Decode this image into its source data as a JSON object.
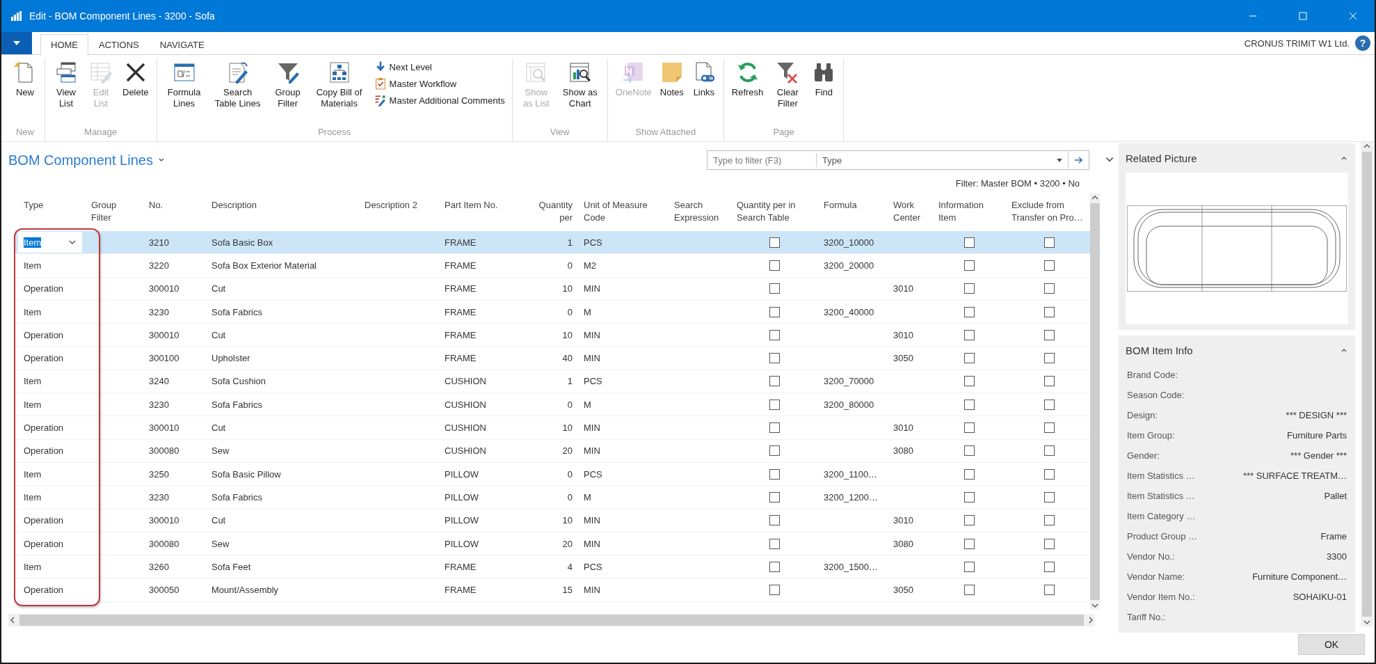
{
  "window": {
    "title": "Edit - BOM Component Lines - 3200 - Sofa"
  },
  "menu_tabs": [
    {
      "label": "HOME",
      "selected": true
    },
    {
      "label": "ACTIONS",
      "selected": false
    },
    {
      "label": "NAVIGATE",
      "selected": false
    }
  ],
  "company": "CRONUS TRIMIT W1 Ltd.",
  "help_button": "?",
  "ribbon": [
    {
      "label": "New",
      "items": [
        {
          "label": "New",
          "kind": "large",
          "disabled": false
        }
      ]
    },
    {
      "label": "Manage",
      "items": [
        {
          "label": "View List",
          "kind": "large",
          "disabled": false
        },
        {
          "label": "Edit List",
          "kind": "large",
          "disabled": true
        },
        {
          "label": "Delete",
          "kind": "large",
          "disabled": false
        }
      ]
    },
    {
      "label": "Process",
      "items": [
        {
          "label": "Formula Lines",
          "kind": "large",
          "disabled": false
        },
        {
          "label": "Search Table Lines",
          "kind": "large",
          "disabled": false
        },
        {
          "label": "Group Filter",
          "kind": "large",
          "disabled": false
        },
        {
          "label": "Copy Bill of Materials",
          "kind": "large",
          "disabled": false
        },
        {
          "label": "Next Level",
          "kind": "small",
          "disabled": false
        },
        {
          "label": "Master Workflow",
          "kind": "small",
          "disabled": false
        },
        {
          "label": "Master Additional Comments",
          "kind": "small",
          "disabled": false
        }
      ]
    },
    {
      "label": "View",
      "items": [
        {
          "label": "Show as List",
          "kind": "large",
          "disabled": true
        },
        {
          "label": "Show as Chart",
          "kind": "large",
          "disabled": false
        }
      ]
    },
    {
      "label": "Show Attached",
      "items": [
        {
          "label": "OneNote",
          "kind": "large",
          "disabled": true
        },
        {
          "label": "Notes",
          "kind": "large",
          "disabled": false
        },
        {
          "label": "Links",
          "kind": "large",
          "disabled": false
        }
      ]
    },
    {
      "label": "Page",
      "items": [
        {
          "label": "Refresh",
          "kind": "large",
          "disabled": false
        },
        {
          "label": "Clear Filter",
          "kind": "large",
          "disabled": false
        },
        {
          "label": "Find",
          "kind": "large",
          "disabled": false
        }
      ]
    }
  ],
  "page": {
    "title": "BOM Component Lines",
    "search": {
      "placeholder": "Type to filter (F3)"
    },
    "filter_field": "Type",
    "filter_text": "Filter: Master BOM • 3200 • No"
  },
  "table": {
    "type_column_outlined": true,
    "columns": [
      {
        "label": "Type",
        "kind": "text"
      },
      {
        "label": "Group Filter",
        "kind": "text"
      },
      {
        "label": "No.",
        "kind": "text"
      },
      {
        "label": "Description",
        "kind": "text"
      },
      {
        "label": "Description 2",
        "kind": "text"
      },
      {
        "label": "Part Item No.",
        "kind": "text"
      },
      {
        "label": "Quantity per",
        "kind": "number"
      },
      {
        "label": "Unit of Measure Code",
        "kind": "text"
      },
      {
        "label": "Search Expression",
        "kind": "text"
      },
      {
        "label": "Quantity per in Search Table",
        "kind": "check"
      },
      {
        "label": "Formula",
        "kind": "text"
      },
      {
        "label": "Work Center",
        "kind": "text"
      },
      {
        "label": "Information Item",
        "kind": "check"
      },
      {
        "label": "Exclude from Transfer on Pro…",
        "kind": "check"
      }
    ],
    "rows": [
      {
        "type": "Item",
        "no": "3210",
        "description": "Sofa Basic Box",
        "part_item_no": "FRAME",
        "quantity_per": "1",
        "unit_of_measure_code": "PCS",
        "quantity_per_in_search_table": false,
        "formula": "3200_10000",
        "information_item": false,
        "exclude_from_transfer": false,
        "selected": true
      },
      {
        "type": "Item",
        "no": "3220",
        "description": "Sofa Box Exterior Material",
        "part_item_no": "FRAME",
        "quantity_per": "0",
        "unit_of_measure_code": "M2",
        "quantity_per_in_search_table": false,
        "formula": "3200_20000",
        "information_item": false,
        "exclude_from_transfer": false,
        "selected": false
      },
      {
        "type": "Operation",
        "no": "300010",
        "description": "Cut",
        "part_item_no": "FRAME",
        "quantity_per": "10",
        "unit_of_measure_code": "MIN",
        "quantity_per_in_search_table": false,
        "work_center": "3010",
        "information_item": false,
        "exclude_from_transfer": false,
        "selected": false
      },
      {
        "type": "Item",
        "no": "3230",
        "description": "Sofa Fabrics",
        "part_item_no": "FRAME",
        "quantity_per": "0",
        "unit_of_measure_code": "M",
        "quantity_per_in_search_table": false,
        "formula": "3200_40000",
        "information_item": false,
        "exclude_from_transfer": false,
        "selected": false
      },
      {
        "type": "Operation",
        "no": "300010",
        "description": "Cut",
        "part_item_no": "FRAME",
        "quantity_per": "10",
        "unit_of_measure_code": "MIN",
        "quantity_per_in_search_table": false,
        "work_center": "3010",
        "information_item": false,
        "exclude_from_transfer": false,
        "selected": false
      },
      {
        "type": "Operation",
        "no": "300100",
        "description": "Upholster",
        "part_item_no": "FRAME",
        "quantity_per": "40",
        "unit_of_measure_code": "MIN",
        "quantity_per_in_search_table": false,
        "work_center": "3050",
        "information_item": false,
        "exclude_from_transfer": false,
        "selected": false
      },
      {
        "type": "Item",
        "no": "3240",
        "description": "Sofa Cushion",
        "part_item_no": "CUSHION",
        "quantity_per": "1",
        "unit_of_measure_code": "PCS",
        "quantity_per_in_search_table": false,
        "formula": "3200_70000",
        "information_item": false,
        "exclude_from_transfer": false,
        "selected": false
      },
      {
        "type": "Item",
        "no": "3230",
        "description": "Sofa Fabrics",
        "part_item_no": "CUSHION",
        "quantity_per": "0",
        "unit_of_measure_code": "M",
        "quantity_per_in_search_table": false,
        "formula": "3200_80000",
        "information_item": false,
        "exclude_from_transfer": false,
        "selected": false
      },
      {
        "type": "Operation",
        "no": "300010",
        "description": "Cut",
        "part_item_no": "CUSHION",
        "quantity_per": "10",
        "unit_of_measure_code": "MIN",
        "quantity_per_in_search_table": false,
        "work_center": "3010",
        "information_item": false,
        "exclude_from_transfer": false,
        "selected": false
      },
      {
        "type": "Operation",
        "no": "300080",
        "description": "Sew",
        "part_item_no": "CUSHION",
        "quantity_per": "20",
        "unit_of_measure_code": "MIN",
        "quantity_per_in_search_table": false,
        "work_center": "3080",
        "information_item": false,
        "exclude_from_transfer": false,
        "selected": false
      },
      {
        "type": "Item",
        "no": "3250",
        "description": "Sofa Basic Pillow",
        "part_item_no": "PILLOW",
        "quantity_per": "0",
        "unit_of_measure_code": "PCS",
        "quantity_per_in_search_table": false,
        "formula": "3200_1100…",
        "information_item": false,
        "exclude_from_transfer": false,
        "selected": false
      },
      {
        "type": "Item",
        "no": "3230",
        "description": "Sofa Fabrics",
        "part_item_no": "PILLOW",
        "quantity_per": "0",
        "unit_of_measure_code": "M",
        "quantity_per_in_search_table": false,
        "formula": "3200_1200…",
        "information_item": false,
        "exclude_from_transfer": false,
        "selected": false
      },
      {
        "type": "Operation",
        "no": "300010",
        "description": "Cut",
        "part_item_no": "PILLOW",
        "quantity_per": "10",
        "unit_of_measure_code": "MIN",
        "quantity_per_in_search_table": false,
        "work_center": "3010",
        "information_item": false,
        "exclude_from_transfer": false,
        "selected": false
      },
      {
        "type": "Operation",
        "no": "300080",
        "description": "Sew",
        "part_item_no": "PILLOW",
        "quantity_per": "20",
        "unit_of_measure_code": "MIN",
        "quantity_per_in_search_table": false,
        "work_center": "3080",
        "information_item": false,
        "exclude_from_transfer": false,
        "selected": false
      },
      {
        "type": "Item",
        "no": "3260",
        "description": "Sofa Feet",
        "part_item_no": "FRAME",
        "quantity_per": "4",
        "unit_of_measure_code": "PCS",
        "quantity_per_in_search_table": false,
        "formula": "3200_1500…",
        "information_item": false,
        "exclude_from_transfer": false,
        "selected": false
      },
      {
        "type": "Operation",
        "no": "300050",
        "description": "Mount/Assembly",
        "part_item_no": "FRAME",
        "quantity_per": "15",
        "unit_of_measure_code": "MIN",
        "quantity_per_in_search_table": false,
        "work_center": "3050",
        "information_item": false,
        "exclude_from_transfer": false,
        "selected": false
      }
    ]
  },
  "factboxes": {
    "related_picture": {
      "title": "Related Picture"
    },
    "bom_item_info": {
      "title": "BOM Item Info",
      "fields": [
        {
          "label": "Brand Code:"
        },
        {
          "label": "Season Code:"
        },
        {
          "label": "Design:",
          "value": "*** DESIGN ***"
        },
        {
          "label": "Item Group:",
          "value": "Furniture Parts"
        },
        {
          "label": "Gender:",
          "value": "*** Gender ***"
        },
        {
          "label": "Item Statistics …",
          "value": "*** SURFACE TREATM…"
        },
        {
          "label": "Item Statistics …",
          "value": "Pallet"
        },
        {
          "label": "Item Category …"
        },
        {
          "label": "Product Group …",
          "value": "Frame"
        },
        {
          "label": "Vendor No.:",
          "value": "3300"
        },
        {
          "label": "Vendor Name:",
          "value": "Furniture Component…"
        },
        {
          "label": "Vendor Item No.:",
          "value": "SOHAIKU-01"
        },
        {
          "label": "Tariff No.:"
        }
      ]
    }
  },
  "buttons": [
    "OK"
  ]
}
